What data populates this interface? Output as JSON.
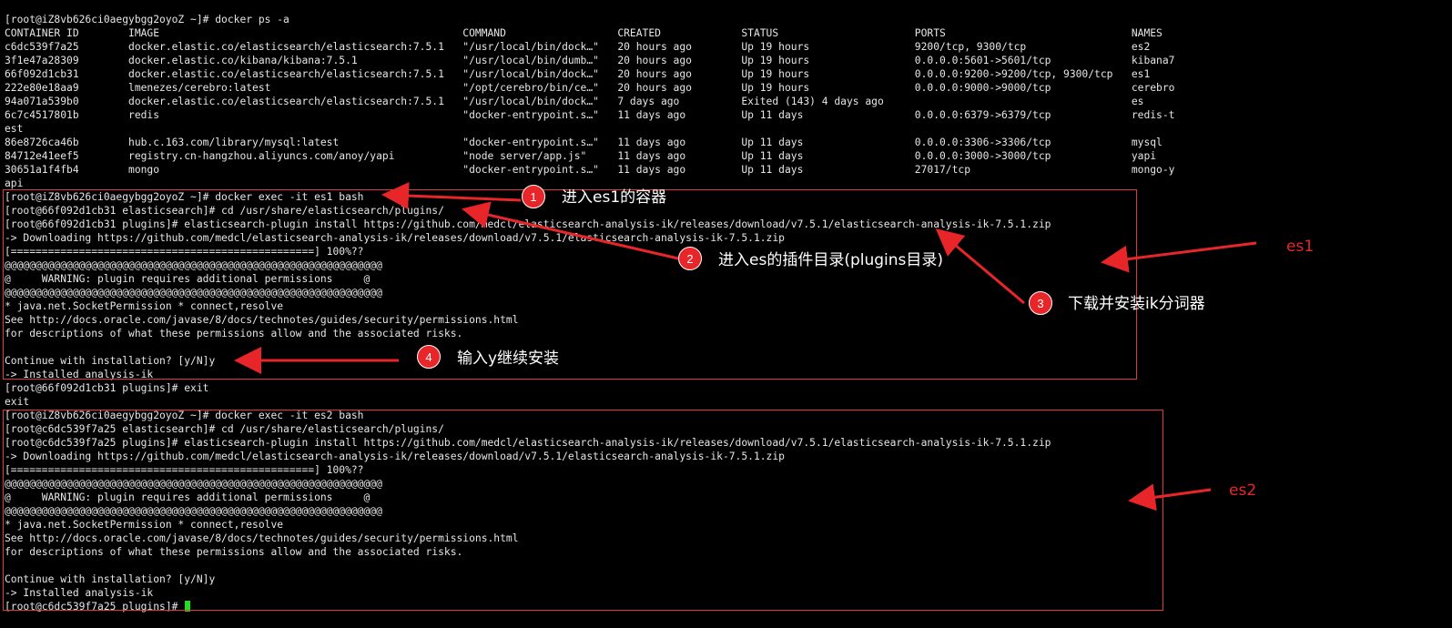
{
  "terminal": {
    "lines": [
      "[root@iZ8vb626ci0aegybgg2oyoZ ~]# docker ps -a",
      "CONTAINER ID        IMAGE                                                 COMMAND                  CREATED             STATUS                      PORTS                              NAMES",
      "c6dc539f7a25        docker.elastic.co/elasticsearch/elasticsearch:7.5.1   \"/usr/local/bin/dock…\"   20 hours ago        Up 19 hours                 9200/tcp, 9300/tcp                 es2",
      "3f1e47a28309        docker.elastic.co/kibana/kibana:7.5.1                 \"/usr/local/bin/dumb…\"   20 hours ago        Up 19 hours                 0.0.0.0:5601->5601/tcp             kibana7",
      "66f092d1cb31        docker.elastic.co/elasticsearch/elasticsearch:7.5.1   \"/usr/local/bin/dock…\"   20 hours ago        Up 19 hours                 0.0.0.0:9200->9200/tcp, 9300/tcp   es1",
      "222e80e18aa9        lmenezes/cerebro:latest                               \"/opt/cerebro/bin/ce…\"   20 hours ago        Up 19 hours                 0.0.0.0:9000->9000/tcp             cerebro",
      "94a071a539b0        docker.elastic.co/elasticsearch/elasticsearch:7.5.1   \"/usr/local/bin/dock…\"   7 days ago          Exited (143) 4 days ago                                        es",
      "6c7c4517801b        redis                                                 \"docker-entrypoint.s…\"   11 days ago         Up 11 days                  0.0.0.0:6379->6379/tcp             redis-t",
      "est",
      "86e8726ca46b        hub.c.163.com/library/mysql:latest                    \"docker-entrypoint.s…\"   11 days ago         Up 11 days                  0.0.0.0:3306->3306/tcp             mysql",
      "84712e41eef5        registry.cn-hangzhou.aliyuncs.com/anoy/yapi           \"node server/app.js\"     11 days ago         Up 11 days                  0.0.0.0:3000->3000/tcp             yapi",
      "30651a1f4fb4        mongo                                                 \"docker-entrypoint.s…\"   11 days ago         Up 11 days                  27017/tcp                          mongo-y",
      "api",
      "[root@iZ8vb626ci0aegybgg2oyoZ ~]# docker exec -it es1 bash",
      "[root@66f092d1cb31 elasticsearch]# cd /usr/share/elasticsearch/plugins/",
      "[root@66f092d1cb31 plugins]# elasticsearch-plugin install https://github.com/medcl/elasticsearch-analysis-ik/releases/download/v7.5.1/elasticsearch-analysis-ik-7.5.1.zip",
      "-> Downloading https://github.com/medcl/elasticsearch-analysis-ik/releases/download/v7.5.1/elasticsearch-analysis-ik-7.5.1.zip",
      "[=================================================] 100%??",
      "@@@@@@@@@@@@@@@@@@@@@@@@@@@@@@@@@@@@@@@@@@@@@@@@@@@@@@@@@@@@@",
      "@     WARNING: plugin requires additional permissions     @",
      "@@@@@@@@@@@@@@@@@@@@@@@@@@@@@@@@@@@@@@@@@@@@@@@@@@@@@@@@@@@@@",
      "* java.net.SocketPermission * connect,resolve",
      "See http://docs.oracle.com/javase/8/docs/technotes/guides/security/permissions.html",
      "for descriptions of what these permissions allow and the associated risks.",
      "",
      "Continue with installation? [y/N]y",
      "-> Installed analysis-ik",
      "[root@66f092d1cb31 plugins]# exit",
      "exit",
      "[root@iZ8vb626ci0aegybgg2oyoZ ~]# docker exec -it es2 bash",
      "[root@c6dc539f7a25 elasticsearch]# cd /usr/share/elasticsearch/plugins/",
      "[root@c6dc539f7a25 plugins]# elasticsearch-plugin install https://github.com/medcl/elasticsearch-analysis-ik/releases/download/v7.5.1/elasticsearch-analysis-ik-7.5.1.zip",
      "-> Downloading https://github.com/medcl/elasticsearch-analysis-ik/releases/download/v7.5.1/elasticsearch-analysis-ik-7.5.1.zip",
      "[=================================================] 100%??",
      "@@@@@@@@@@@@@@@@@@@@@@@@@@@@@@@@@@@@@@@@@@@@@@@@@@@@@@@@@@@@@",
      "@     WARNING: plugin requires additional permissions     @",
      "@@@@@@@@@@@@@@@@@@@@@@@@@@@@@@@@@@@@@@@@@@@@@@@@@@@@@@@@@@@@@",
      "* java.net.SocketPermission * connect,resolve",
      "See http://docs.oracle.com/javase/8/docs/technotes/guides/security/permissions.html",
      "for descriptions of what these permissions allow and the associated risks.",
      "",
      "Continue with installation? [y/N]y",
      "-> Installed analysis-ik",
      "[root@c6dc539f7a25 plugins]# "
    ]
  },
  "annotations": {
    "steps": [
      {
        "number": "1",
        "label": "进入es1的容器"
      },
      {
        "number": "2",
        "label": "进入es的插件目录(plugins目录)"
      },
      {
        "number": "3",
        "label": "下载并安装ik分词器"
      },
      {
        "number": "4",
        "label": "输入y继续安装"
      }
    ],
    "es1_label": "es1",
    "es2_label": "es2"
  },
  "colors": {
    "annotation_red": "#e8262a",
    "cursor_green": "#22dd22",
    "terminal_bg": "#000000",
    "terminal_fg": "#e6e6e6"
  }
}
